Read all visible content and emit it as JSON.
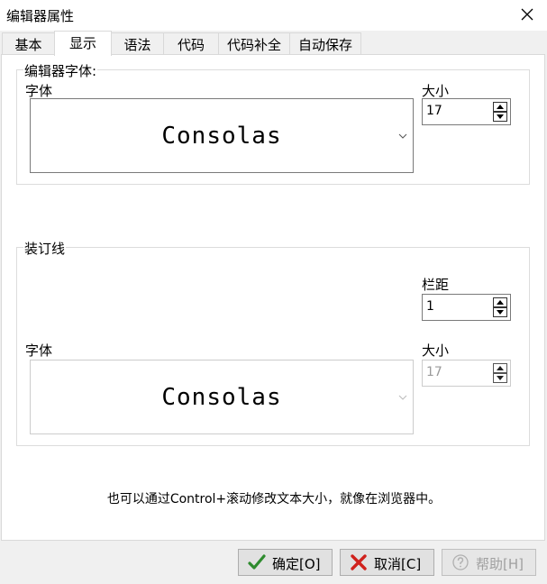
{
  "window": {
    "title": "编辑器属性"
  },
  "tabs": [
    {
      "label": "基本"
    },
    {
      "label": "显示"
    },
    {
      "label": "语法"
    },
    {
      "label": "代码"
    },
    {
      "label": "代码补全"
    },
    {
      "label": "自动保存"
    }
  ],
  "active_tab": "显示",
  "editor_font_group": {
    "title": "编辑器字体",
    "font_label": "字体",
    "font_value": "Consolas",
    "size_label": "大小",
    "size_value": "17"
  },
  "gutter_group": {
    "title": "装订线",
    "margin_label": "栏距",
    "margin_value": "1",
    "font_label": "字体",
    "font_value": "Consolas",
    "size_label": "大小",
    "size_value": "17"
  },
  "hint": "也可以通过Control+滚动修改文本大小，就像在浏览器中。",
  "buttons": {
    "ok": "确定[O]",
    "cancel": "取消[C]",
    "help": "帮助[H]"
  },
  "colors": {
    "ok_check": "#2e8b2e",
    "cancel_x": "#d0211c"
  }
}
